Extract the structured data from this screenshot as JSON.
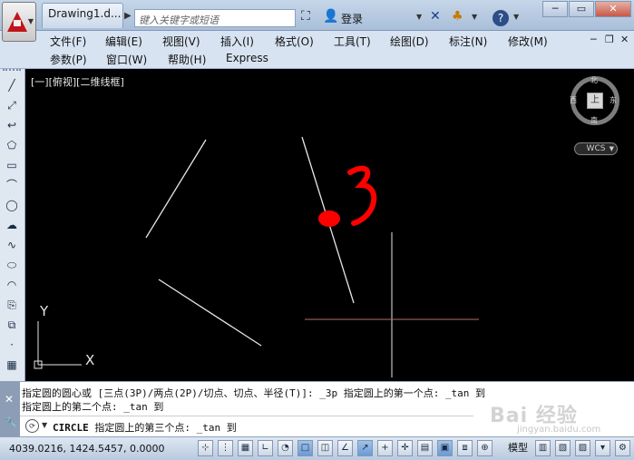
{
  "title_bar": {
    "document_tab": "Drawing1.d...",
    "search_placeholder": "键入关键字或短语",
    "login_label": "登录",
    "icons": [
      "binoculars-icon",
      "user-icon",
      "exchange-icon",
      "a360-icon",
      "help-icon"
    ],
    "window_controls": {
      "minimize": "─",
      "restore": "▭",
      "close": "✕"
    }
  },
  "menu": {
    "row1": [
      "文件(F)",
      "编辑(E)",
      "视图(V)",
      "插入(I)",
      "格式(O)",
      "工具(T)",
      "绘图(D)",
      "标注(N)",
      "修改(M)"
    ],
    "row2": [
      "参数(P)",
      "窗口(W)",
      "帮助(H)",
      "Express"
    ],
    "mdi_controls": {
      "minimize": "─",
      "restore": "❐",
      "close": "✕"
    }
  },
  "left_toolbar": {
    "tools": [
      "line",
      "construction-line",
      "polyline",
      "polygon",
      "rectangle",
      "arc",
      "circle",
      "revision-cloud",
      "spline",
      "ellipse",
      "ellipse-arc",
      "insert-block",
      "make-block",
      "point",
      "hatch"
    ]
  },
  "viewport": {
    "label": "[一][俯视][二维线框]",
    "viewcube": {
      "face": "上",
      "north": "北",
      "south": "南",
      "east": "东",
      "west": "西"
    },
    "wcs": "WCS",
    "ucs_icon": {
      "x_label": "X",
      "y_label": "Y"
    },
    "annotation": "3",
    "colors": {
      "background": "#000000",
      "line": "#e6e6e6",
      "annotation": "#ff0000"
    }
  },
  "command": {
    "history": [
      "指定圆的圆心或 [三点(3P)/两点(2P)/切点、切点、半径(T)]: _3p 指定圆上的第一个点: _tan 到",
      "指定圆上的第二个点: _tan 到"
    ],
    "keyword": "CIRCLE",
    "active_prompt": "指定圆上的第三个点: _tan 到"
  },
  "status": {
    "coordinates": "4039.0216, 1424.5457, 0.0000",
    "model_label": "模型"
  },
  "watermark": {
    "main": "Bai 经验",
    "sub": "jingyan.baidu.com"
  }
}
